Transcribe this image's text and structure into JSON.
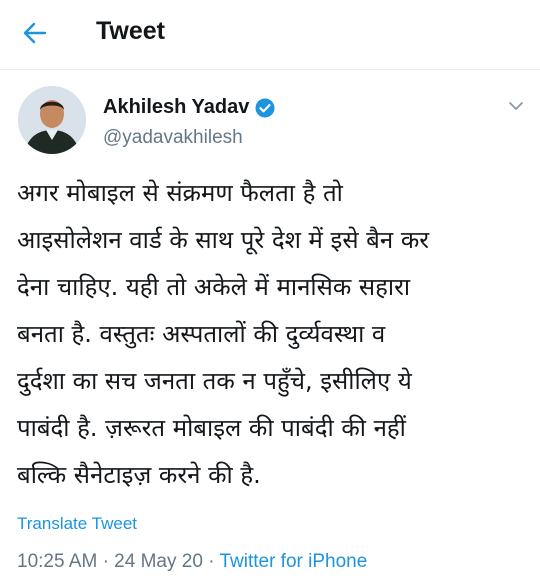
{
  "header": {
    "title": "Tweet",
    "back_icon": "arrow-left-icon"
  },
  "colors": {
    "accent": "#1b95e0",
    "secondary_text": "#657786",
    "primary_text": "#14171a"
  },
  "tweet": {
    "author": {
      "name": "Akhilesh Yadav",
      "handle": "@yadavakhilesh",
      "verified_icon": "verified-badge-icon"
    },
    "menu_icon": "chevron-down-icon",
    "text_lines": [
      "अगर मोबाइल से संक्रमण फैलता है तो",
      "आइसोलेशन वार्ड के साथ पूरे देश में इसे बैन कर",
      "देना चाहिए. यही तो अकेले में मानसिक सहारा",
      "बनता है. वस्तुतः अस्पतालों की दुर्व्यवस्था व",
      "दुर्दशा का सच जनता तक न पहुँचे, इसीलिए ये",
      "पाबंदी है. ज़रूरत मोबाइल की पाबंदी की नहीं",
      "बल्कि सैनेटाइज़ करने की है."
    ],
    "translate_label": "Translate Tweet",
    "time": "10:25 AM",
    "date": "24 May 20",
    "separator": "·",
    "source": "Twitter for iPhone"
  }
}
